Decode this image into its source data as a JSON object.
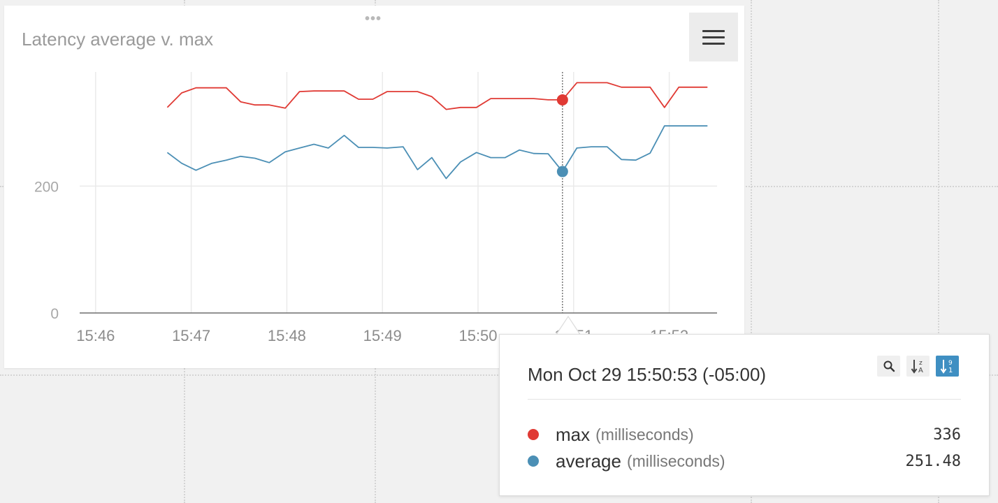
{
  "panel": {
    "title": "Latency average v. max",
    "drag_handle": "•••"
  },
  "chart_data": {
    "type": "line",
    "title": "Latency average v. max",
    "xlabel": "",
    "ylabel": "",
    "x_ticks": [
      "15:46",
      "15:47",
      "15:48",
      "15:49",
      "15:50",
      "15:51",
      "15:52"
    ],
    "y_ticks": [
      0,
      200
    ],
    "ylim": [
      0,
      380
    ],
    "xlim": [
      "15:45:50",
      "15:52:30"
    ],
    "grid": true,
    "cursor_time": "15:50:53",
    "series": [
      {
        "name": "max",
        "color": "#e03a34",
        "x": [
          "15:46:45",
          "15:46:54",
          "15:47:03",
          "15:47:13",
          "15:47:22",
          "15:47:31",
          "15:47:40",
          "15:47:49",
          "15:47:59",
          "15:48:08",
          "15:48:17",
          "15:48:26",
          "15:48:36",
          "15:48:45",
          "15:48:54",
          "15:49:03",
          "15:49:13",
          "15:49:22",
          "15:49:31",
          "15:49:40",
          "15:49:49",
          "15:49:59",
          "15:50:08",
          "15:50:17",
          "15:50:26",
          "15:50:35",
          "15:50:44",
          "15:50:53",
          "15:51:02",
          "15:51:11",
          "15:51:21",
          "15:51:30",
          "15:51:39",
          "15:51:48",
          "15:51:57",
          "15:52:06",
          "15:52:16",
          "15:52:24"
        ],
        "values": [
          324,
          347,
          355,
          355,
          355,
          333,
          328,
          328,
          323,
          349,
          350,
          350,
          350,
          337,
          337,
          349,
          349,
          349,
          341,
          321,
          324,
          324,
          338,
          338,
          338,
          338,
          336,
          336,
          363,
          363,
          363,
          356,
          356,
          356,
          324,
          356,
          356,
          356
        ]
      },
      {
        "name": "average",
        "color": "#4b8fb5",
        "x": [
          "15:46:45",
          "15:46:54",
          "15:47:03",
          "15:47:13",
          "15:47:22",
          "15:47:31",
          "15:47:40",
          "15:47:49",
          "15:47:59",
          "15:48:08",
          "15:48:17",
          "15:48:26",
          "15:48:36",
          "15:48:45",
          "15:48:54",
          "15:49:03",
          "15:49:13",
          "15:49:22",
          "15:49:31",
          "15:49:40",
          "15:49:49",
          "15:49:59",
          "15:50:08",
          "15:50:17",
          "15:50:26",
          "15:50:35",
          "15:50:44",
          "15:50:53",
          "15:51:02",
          "15:51:11",
          "15:51:21",
          "15:51:30",
          "15:51:39",
          "15:51:48",
          "15:51:57",
          "15:52:06",
          "15:52:16",
          "15:52:24"
        ],
        "values": [
          253,
          236,
          225,
          236,
          241,
          247,
          244,
          237,
          254,
          260,
          266,
          260,
          280,
          261,
          261,
          260,
          262,
          226,
          245,
          212,
          238,
          253,
          245,
          245,
          257,
          251.48,
          251,
          223,
          260,
          262,
          262,
          242,
          241,
          252,
          295,
          295,
          295,
          295
        ]
      }
    ]
  },
  "tooltip": {
    "datetime": "Mon Oct 29 15:50:53 (-05:00)",
    "tools": [
      {
        "icon": "search-icon"
      },
      {
        "icon": "sort-alpha-icon"
      },
      {
        "icon": "sort-numeric-icon",
        "active": true
      }
    ],
    "rows": [
      {
        "name": "max",
        "unit": "(milliseconds)",
        "value": "336",
        "color": "#e03a34"
      },
      {
        "name": "average",
        "unit": "(milliseconds)",
        "value": "251.48",
        "color": "#4b8fb5"
      }
    ]
  }
}
